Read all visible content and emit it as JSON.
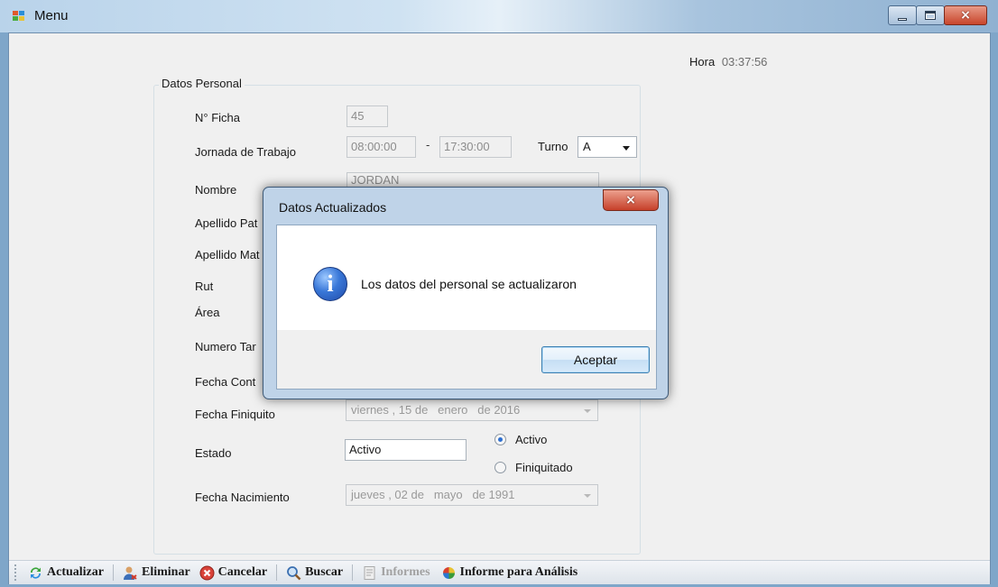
{
  "window": {
    "title": "Menu",
    "icon": "app-window-icon",
    "controls": {
      "minimize": "minimize-icon",
      "maximize": "maximize-icon",
      "close": "×"
    }
  },
  "clock": {
    "label": "Hora",
    "value": "03:37:56"
  },
  "form": {
    "group_title": "Datos Personal",
    "labels": {
      "ficha": "N° Ficha",
      "jornada": "Jornada de Trabajo",
      "nombre": "Nombre",
      "apellido_pat": "Apellido Pat",
      "apellido_mat": "Apellido Mat",
      "rut": "Rut",
      "area": "Área",
      "numero_tarjeta": "Numero Tar",
      "fecha_contrato": "Fecha Cont",
      "fecha_finiquito": "Fecha Finiquito",
      "estado": "Estado",
      "fecha_nacimiento": "Fecha Nacimiento",
      "turno": "Turno"
    },
    "values": {
      "ficha": "45",
      "jornada_inicio": "08:00:00",
      "jornada_separator": "-",
      "jornada_fin": "17:30:00",
      "turno": "A",
      "nombre": "JORDAN",
      "estado": "Activo"
    },
    "fecha_finiquito": {
      "day_name": "viernes",
      "day": "15 de",
      "month": "enero",
      "year": "de 2016"
    },
    "fecha_nacimiento": {
      "day_name": "jueves",
      "day": "02 de",
      "month": "mayo",
      "year": "de 1991"
    },
    "estado_options": [
      {
        "label": "Activo",
        "selected": true
      },
      {
        "label": "Finiquitado",
        "selected": false
      }
    ]
  },
  "dialog": {
    "title": "Datos Actualizados",
    "close_glyph": "×",
    "icon": "info-icon",
    "icon_glyph": "i",
    "message": "Los datos del personal se actualizaron",
    "ok_label": "Aceptar"
  },
  "toolbar": {
    "actualizar": "Actualizar",
    "eliminar": "Eliminar",
    "cancelar": "Cancelar",
    "buscar": "Buscar",
    "informes": "Informes",
    "informe_analisis": "Informe para Análisis"
  },
  "colors": {
    "title_bar": "#b9d3ea",
    "client_bg": "#f0f0f0",
    "dialog_frame": "#bfd3e8",
    "close_red": "#c6402a",
    "radio_selected": "#2e6fd0"
  }
}
